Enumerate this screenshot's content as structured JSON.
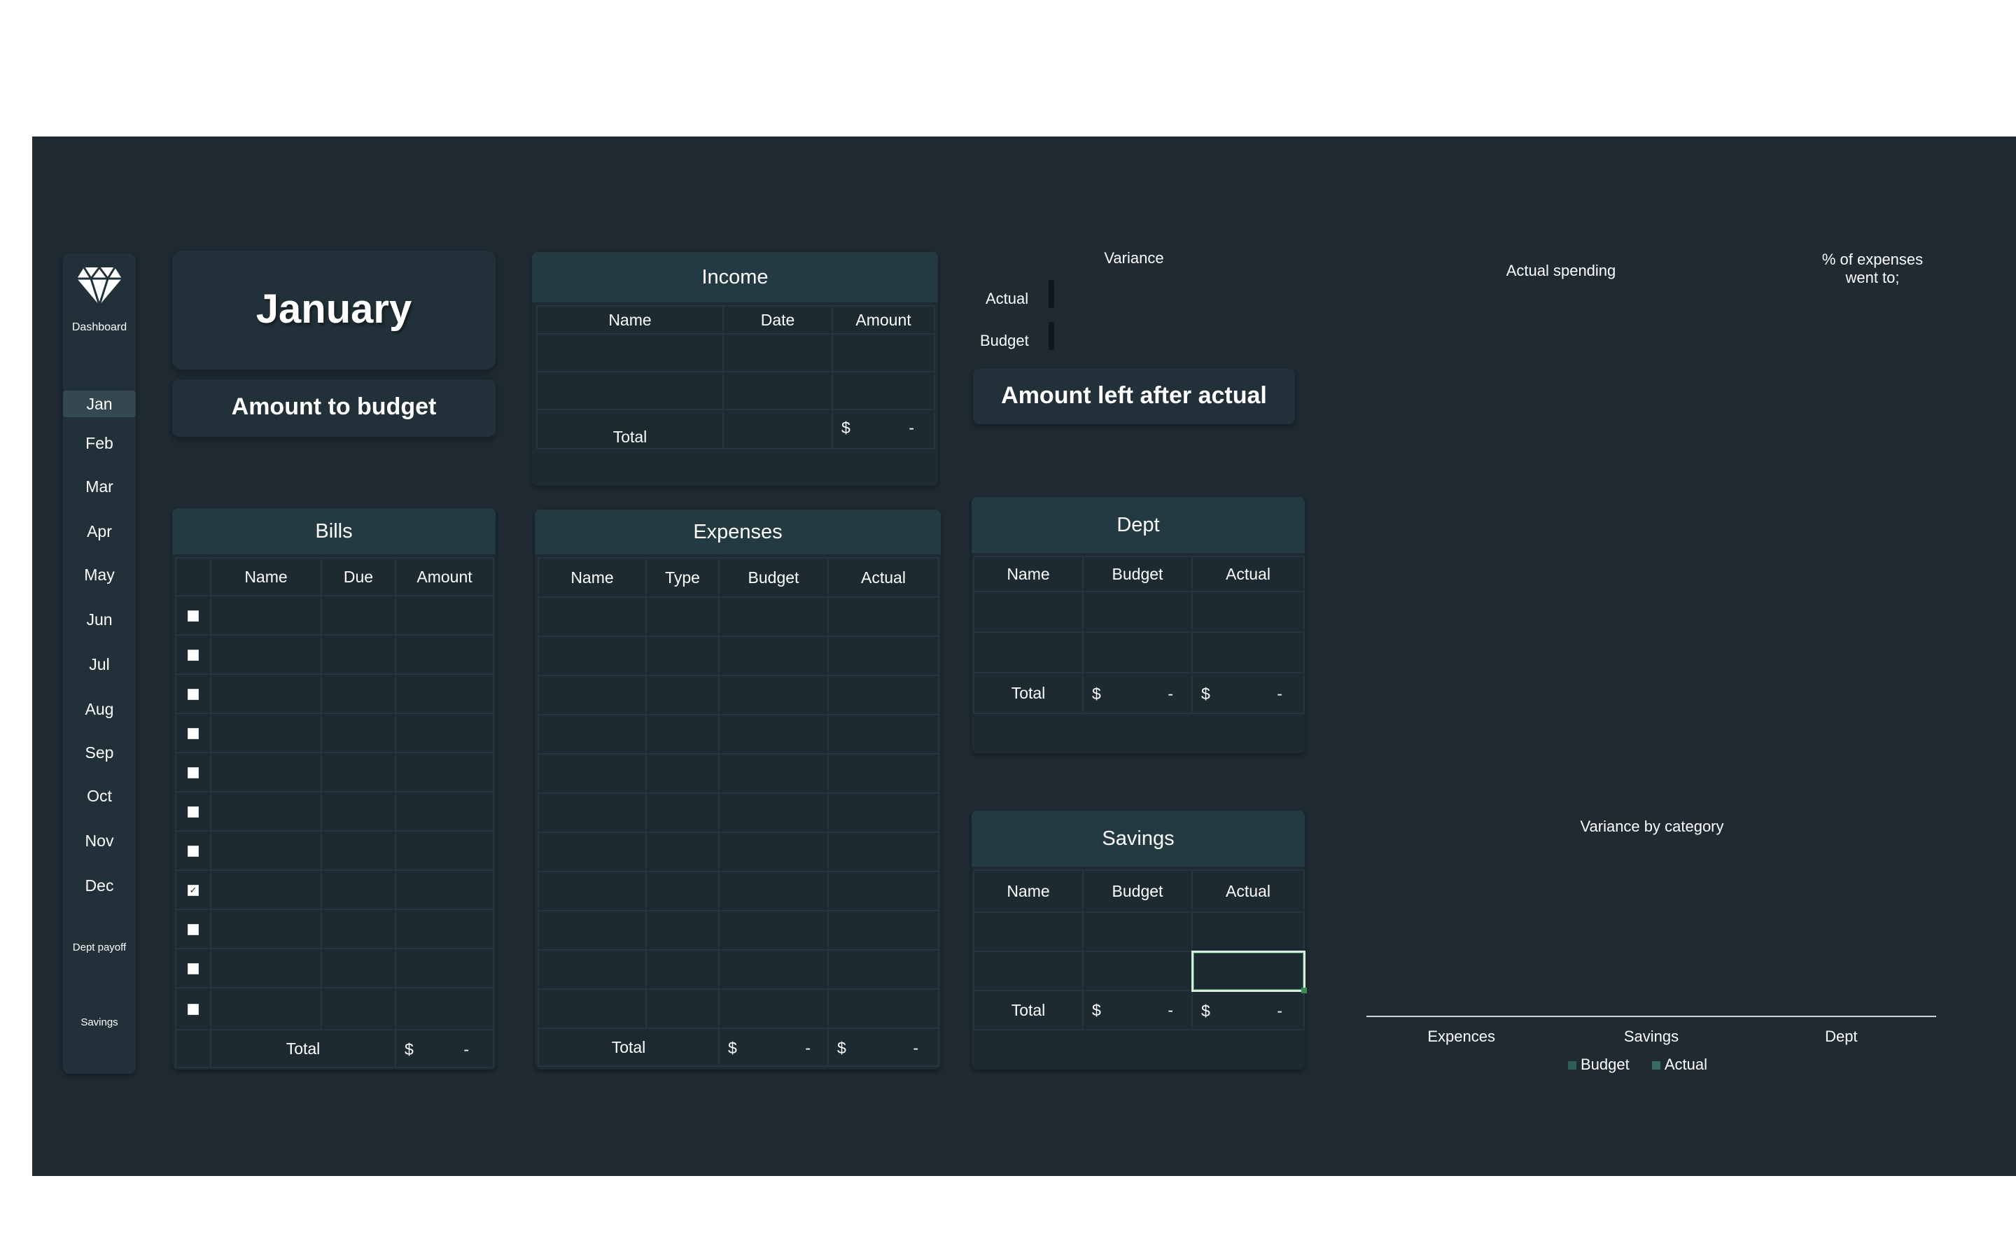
{
  "nav": {
    "logo_label": "Dashboard",
    "months": [
      "Jan",
      "Feb",
      "Mar",
      "Apr",
      "May",
      "Jun",
      "Jul",
      "Aug",
      "Sep",
      "Oct",
      "Nov",
      "Dec"
    ],
    "active": "Jan",
    "dept_payoff": "Dept payoff",
    "savings": "Savings"
  },
  "header": {
    "month": "January",
    "amount_to_budget": "Amount to budget"
  },
  "income": {
    "title": "Income",
    "columns": [
      "Name",
      "Date",
      "Amount"
    ],
    "total_label": "Total",
    "total_currency": "$",
    "total_value": "-"
  },
  "bills": {
    "title": "Bills",
    "columns": [
      "Name",
      "Due",
      "Amount"
    ],
    "checks": [
      false,
      false,
      false,
      false,
      false,
      false,
      false,
      true,
      false,
      false,
      false
    ],
    "total_label": "Total",
    "total_currency": "$",
    "total_value": "-"
  },
  "expenses": {
    "title": "Expenses",
    "columns": [
      "Name",
      "Type",
      "Budget",
      "Actual"
    ],
    "total_label": "Total",
    "budget_currency": "$",
    "budget_value": "-",
    "actual_currency": "$",
    "actual_value": "-"
  },
  "variance": {
    "title": "Variance",
    "actual_label": "Actual",
    "budget_label": "Budget"
  },
  "amount_left": "Amount left after actual",
  "dept": {
    "title": "Dept",
    "columns": [
      "Name",
      "Budget",
      "Actual"
    ],
    "total_label": "Total",
    "budget_currency": "$",
    "budget_value": "-",
    "actual_currency": "$",
    "actual_value": "-"
  },
  "savings": {
    "title": "Savings",
    "columns": [
      "Name",
      "Budget",
      "Actual"
    ],
    "total_label": "Total",
    "budget_currency": "$",
    "budget_value": "-",
    "actual_currency": "$",
    "actual_value": "-"
  },
  "charts": {
    "actual_spending_title": "Actual spending",
    "percent_title": "% of expenses went to;"
  },
  "chart_data": {
    "type": "bar",
    "title": "Variance by category",
    "categories": [
      "Expences",
      "Savings",
      "Dept"
    ],
    "series": [
      {
        "name": "Budget",
        "values": [
          0,
          0,
          0
        ]
      },
      {
        "name": "Actual",
        "values": [
          0,
          0,
          0
        ]
      }
    ],
    "colors": {
      "Budget": "#2e5d5a",
      "Actual": "#3a6b63"
    }
  }
}
